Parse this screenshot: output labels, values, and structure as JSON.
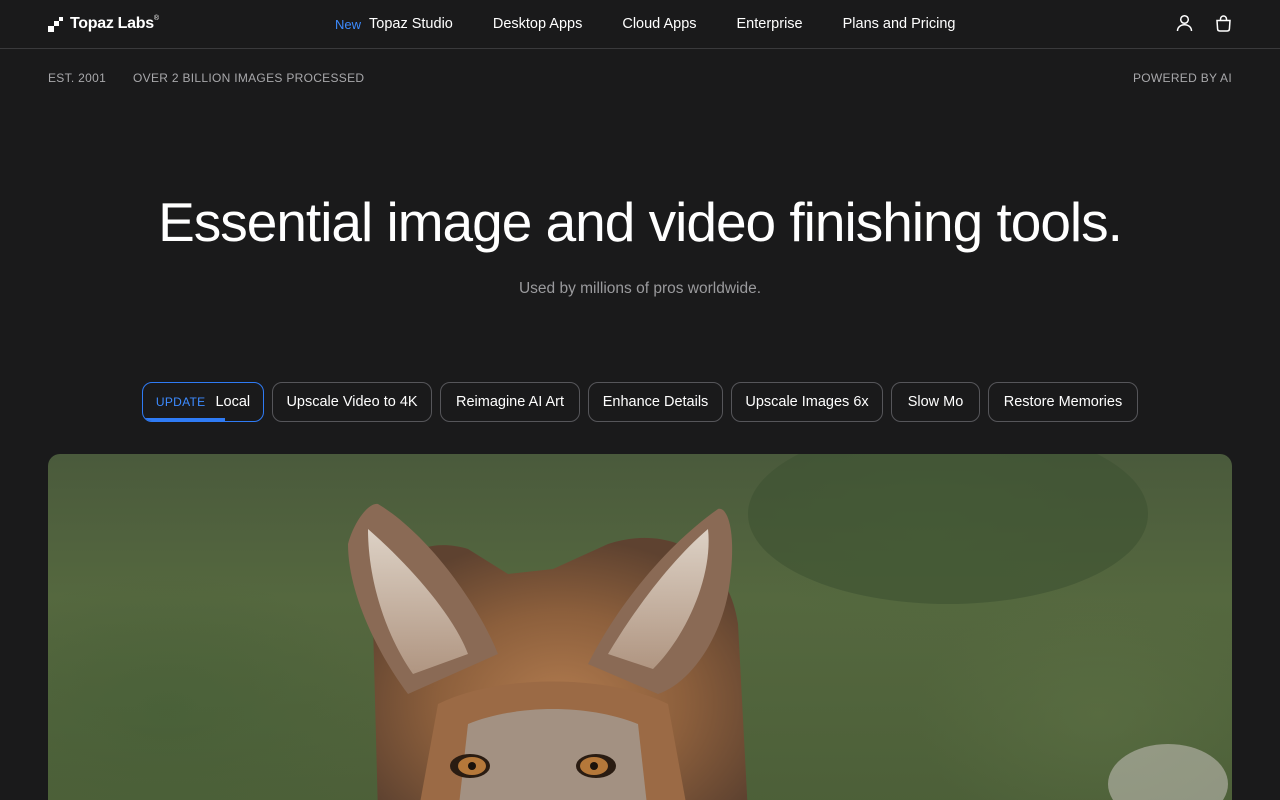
{
  "brand": {
    "name": "Topaz Labs",
    "mark": "®"
  },
  "nav": {
    "new_tag": "New",
    "items": [
      "Topaz Studio",
      "Desktop Apps",
      "Cloud Apps",
      "Enterprise",
      "Plans and Pricing"
    ],
    "icons": [
      "user-icon",
      "shopping-bag-icon"
    ]
  },
  "meta": {
    "established": "EST. 2001",
    "images_processed": "OVER 2 BILLION IMAGES PROCESSED",
    "powered_by": "POWERED BY AI"
  },
  "hero": {
    "title": "Essential image and video finishing tools.",
    "subtitle": "Used by millions of pros worldwide."
  },
  "tabs": {
    "active_badge": "UPDATE",
    "active_progress": 0.68,
    "items": [
      "Local",
      "Upscale Video to 4K",
      "Reimagine AI Art",
      "Enhance Details",
      "Upscale Images 6x",
      "Slow Mo",
      "Restore Memories"
    ]
  },
  "colors": {
    "background": "#1a1a1b",
    "accent": "#2f7bf5",
    "accent_text": "#3d8bff",
    "muted_text": "#a8a8ab",
    "border": "#56565a"
  },
  "showcase": {
    "subject": "coyote-photo"
  }
}
